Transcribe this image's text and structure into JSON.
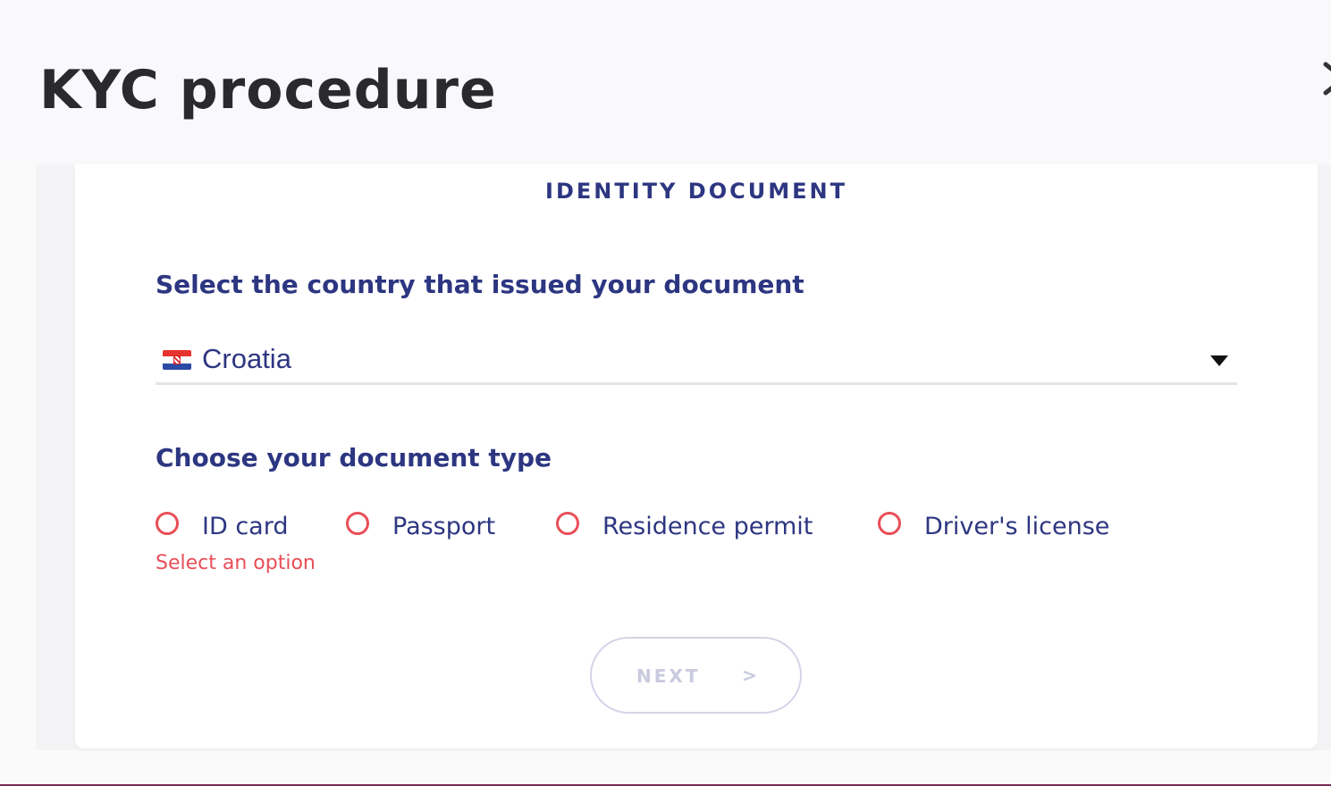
{
  "header": {
    "title": "KYC procedure"
  },
  "card": {
    "section_title": "IDENTITY DOCUMENT",
    "country": {
      "label": "Select the country that issued your document",
      "selected_value": "Croatia",
      "flag_icon": "croatia-flag-icon"
    },
    "document_type": {
      "label": "Choose your document type",
      "options": [
        {
          "label": "ID card",
          "selected": false
        },
        {
          "label": "Passport",
          "selected": false
        },
        {
          "label": "Residence permit",
          "selected": false
        },
        {
          "label": "Driver's license",
          "selected": false
        }
      ],
      "error": "Select an option"
    },
    "next_button": {
      "label": "NEXT",
      "arrow": ">",
      "enabled": false
    }
  },
  "colors": {
    "primary": "#2d3681",
    "error": "#e94e57",
    "disabled": "#c9cade",
    "title": "#2a2a2e"
  }
}
